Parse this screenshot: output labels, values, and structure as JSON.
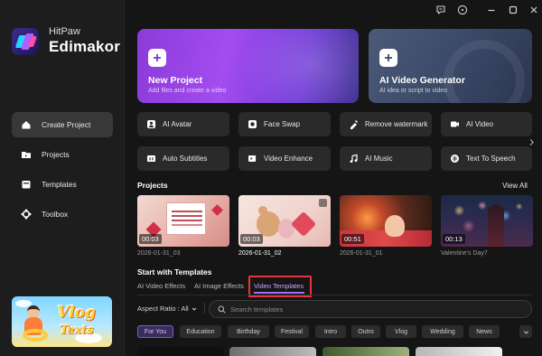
{
  "app": {
    "brand_top": "HitPaw",
    "brand_main": "Edimakor"
  },
  "topbar": {
    "icons": [
      "feedback-icon",
      "info-icon",
      "minimize-icon",
      "maximize-icon",
      "close-icon"
    ]
  },
  "sidebar": {
    "items": [
      {
        "label": "Create Project",
        "icon": "home-icon",
        "active": true
      },
      {
        "label": "Projects",
        "icon": "folder-icon",
        "active": false
      },
      {
        "label": "Templates",
        "icon": "templates-icon",
        "active": false
      },
      {
        "label": "Toolbox",
        "icon": "toolbox-icon",
        "active": false
      }
    ],
    "banner": {
      "line1": "Vlog",
      "line2": "Texts"
    }
  },
  "hero": {
    "new_project": {
      "title": "New Project",
      "subtitle": "Add files and create a video"
    },
    "ai_video": {
      "title": "AI Video Generator",
      "subtitle": "AI idea or script to video"
    }
  },
  "tools": [
    {
      "label": "AI Avatar",
      "icon": "avatar-icon"
    },
    {
      "label": "Face Swap",
      "icon": "face-swap-icon"
    },
    {
      "label": "Remove watermark",
      "icon": "watermark-icon"
    },
    {
      "label": "AI Video",
      "icon": "ai-video-icon"
    },
    {
      "label": "Auto Subtitles",
      "icon": "subtitles-icon"
    },
    {
      "label": "Video Enhance",
      "icon": "enhance-icon"
    },
    {
      "label": "AI Music",
      "icon": "music-icon"
    },
    {
      "label": "Text To Speech",
      "icon": "tts-icon"
    }
  ],
  "projects": {
    "title": "Projects",
    "view_all": "View All",
    "items": [
      {
        "name": "2026-01-31_03",
        "duration": "00:03",
        "selected": false
      },
      {
        "name": "2026-01-31_02",
        "duration": "00:03",
        "selected": true
      },
      {
        "name": "2026-01-31_01",
        "duration": "00:51",
        "selected": false
      },
      {
        "name": "Valentine's Day7",
        "duration": "00:13",
        "selected": false
      }
    ]
  },
  "templates": {
    "title": "Start with Templates",
    "tabs": [
      {
        "label": "AI Video Effects",
        "active": false
      },
      {
        "label": "AI Image Effects",
        "active": false
      },
      {
        "label": "Video Templates",
        "active": true
      }
    ],
    "aspect_label": "Aspect Ratio : All",
    "search_placeholder": "Search templates",
    "chips": [
      {
        "label": "For You",
        "active": true
      },
      {
        "label": "Education",
        "active": false
      },
      {
        "label": "Birthday",
        "active": false
      },
      {
        "label": "Festival",
        "active": false
      },
      {
        "label": "Intro",
        "active": false
      },
      {
        "label": "Outro",
        "active": false
      },
      {
        "label": "Vlog",
        "active": false
      },
      {
        "label": "Wedding",
        "active": false
      },
      {
        "label": "News",
        "active": false
      }
    ]
  },
  "colors": {
    "accent": "#a06bff",
    "highlight": "#e8343f",
    "background": "#151515",
    "sidebar": "#1d1d1d"
  }
}
